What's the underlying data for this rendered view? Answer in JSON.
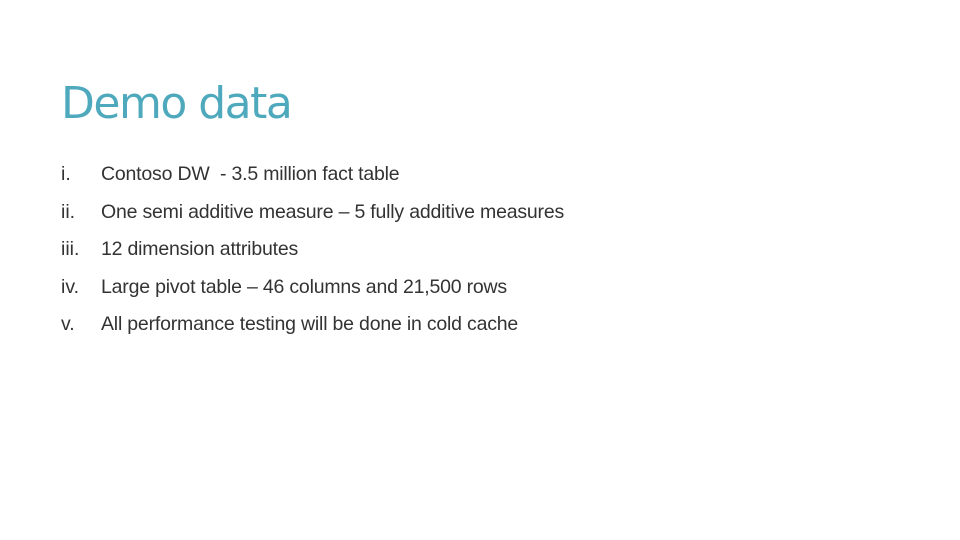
{
  "slide": {
    "title": "Demo data",
    "items": [
      {
        "marker": "i.",
        "text": "Contoso DW  - 3.5 million fact table"
      },
      {
        "marker": "ii.",
        "text": "One semi additive measure – 5 fully additive measures"
      },
      {
        "marker": "iii.",
        "text": "12 dimension attributes"
      },
      {
        "marker": "iv.",
        "text": "Large pivot table – 46 columns and 21,500 rows"
      },
      {
        "marker": "v.",
        "text": "All performance testing will be done in cold cache"
      }
    ]
  },
  "colors": {
    "title": "#4fa9bd",
    "body_text": "#333333",
    "background": "#ffffff"
  }
}
